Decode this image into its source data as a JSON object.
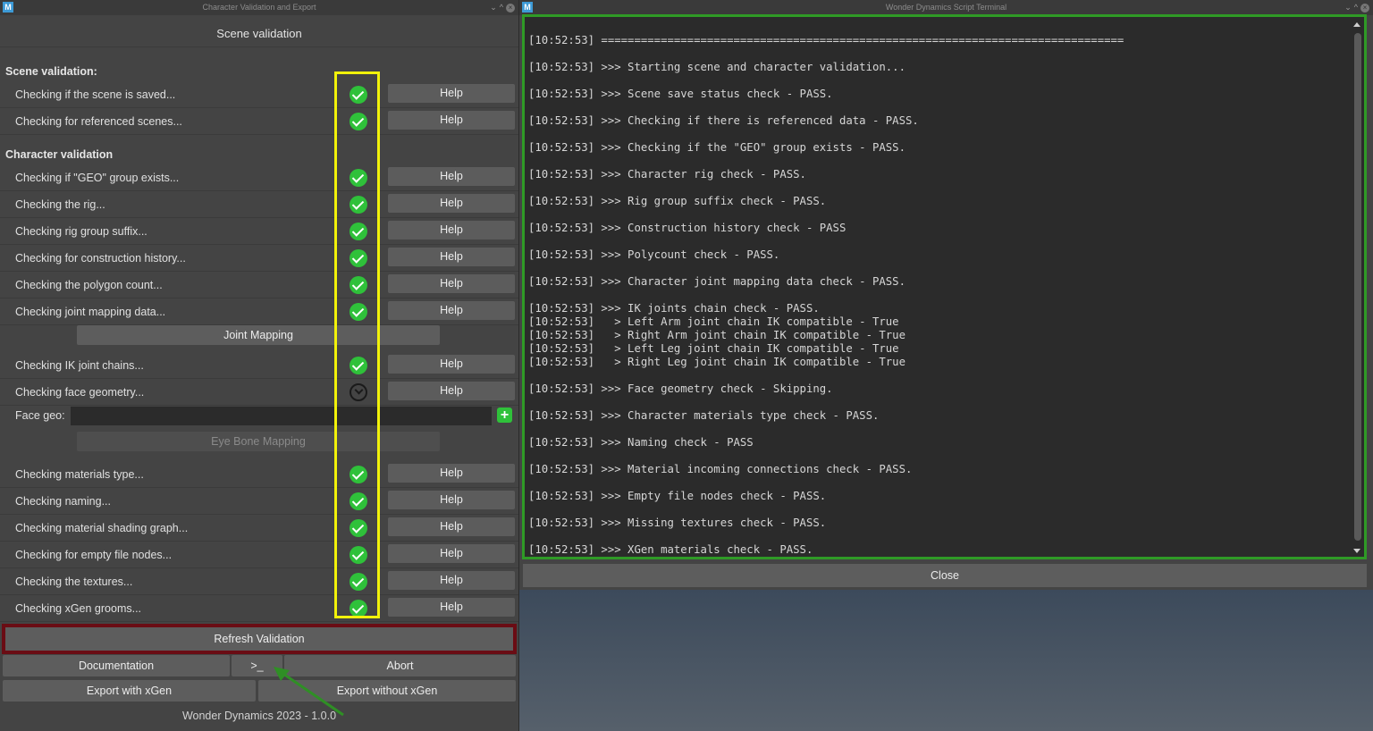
{
  "left_window": {
    "title": "Character Validation and Export",
    "icon_letter": "M",
    "header": "Scene validation",
    "scene_section_title": "Scene validation:",
    "character_section_title": "Character validation",
    "help_label": "Help",
    "scene_checks": [
      {
        "label": "Checking if the scene is saved...",
        "status": "pass"
      },
      {
        "label": "Checking for referenced scenes...",
        "status": "pass"
      }
    ],
    "character_checks": [
      {
        "label": "Checking if \"GEO\" group exists...",
        "status": "pass"
      },
      {
        "label": "Checking the rig...",
        "status": "pass"
      },
      {
        "label": "Checking rig group suffix...",
        "status": "pass"
      },
      {
        "label": "Checking for construction history...",
        "status": "pass"
      },
      {
        "label": "Checking the polygon count...",
        "status": "pass"
      },
      {
        "label": "Checking joint mapping data...",
        "status": "pass"
      }
    ],
    "joint_mapping_button": "Joint Mapping",
    "ik_checks": [
      {
        "label": "Checking IK joint chains...",
        "status": "pass"
      },
      {
        "label": "Checking face geometry...",
        "status": "skip"
      }
    ],
    "face_geo_label": "Face geo:",
    "face_geo_value": "",
    "eye_bone_button": "Eye Bone Mapping",
    "material_checks": [
      {
        "label": "Checking materials type...",
        "status": "pass"
      },
      {
        "label": "Checking naming...",
        "status": "pass"
      },
      {
        "label": "Checking material shading graph...",
        "status": "pass"
      },
      {
        "label": "Checking for empty file nodes...",
        "status": "pass"
      },
      {
        "label": "Checking the textures...",
        "status": "pass"
      },
      {
        "label": "Checking xGen grooms...",
        "status": "pass"
      }
    ],
    "refresh_button": "Refresh Validation",
    "documentation_button": "Documentation",
    "terminal_button": ">_",
    "abort_button": "Abort",
    "export_xgen_button": "Export with xGen",
    "export_no_xgen_button": "Export without xGen",
    "footer": "Wonder Dynamics 2023 - 1.0.0"
  },
  "right_window": {
    "title": "Wonder Dynamics Script Terminal",
    "icon_letter": "M",
    "close_button": "Close",
    "log_lines": [
      "[10:52:53] ===============================================================================",
      "",
      "[10:52:53] >>> Starting scene and character validation...",
      "",
      "[10:52:53] >>> Scene save status check - PASS.",
      "",
      "[10:52:53] >>> Checking if there is referenced data - PASS.",
      "",
      "[10:52:53] >>> Checking if the \"GEO\" group exists - PASS.",
      "",
      "[10:52:53] >>> Character rig check - PASS.",
      "",
      "[10:52:53] >>> Rig group suffix check - PASS.",
      "",
      "[10:52:53] >>> Construction history check - PASS",
      "",
      "[10:52:53] >>> Polycount check - PASS.",
      "",
      "[10:52:53] >>> Character joint mapping data check - PASS.",
      "",
      "[10:52:53] >>> IK joints chain check - PASS.",
      "[10:52:53]   > Left Arm joint chain IK compatible - True",
      "[10:52:53]   > Right Arm joint chain IK compatible - True",
      "[10:52:53]   > Left Leg joint chain IK compatible - True",
      "[10:52:53]   > Right Leg joint chain IK compatible - True",
      "",
      "[10:52:53] >>> Face geometry check - Skipping.",
      "",
      "[10:52:53] >>> Character materials type check - PASS.",
      "",
      "[10:52:53] >>> Naming check - PASS",
      "",
      "[10:52:53] >>> Material incoming connections check - PASS.",
      "",
      "[10:52:53] >>> Empty file nodes check - PASS.",
      "",
      "[10:52:53] >>> Missing textures check - PASS.",
      "",
      "[10:52:53] >>> XGen materials check - PASS."
    ]
  },
  "colors": {
    "pass": "#2fc13a",
    "highlight_yellow": "#f2f20a",
    "highlight_red": "#6a0c14",
    "highlight_green": "#2f9a26"
  }
}
